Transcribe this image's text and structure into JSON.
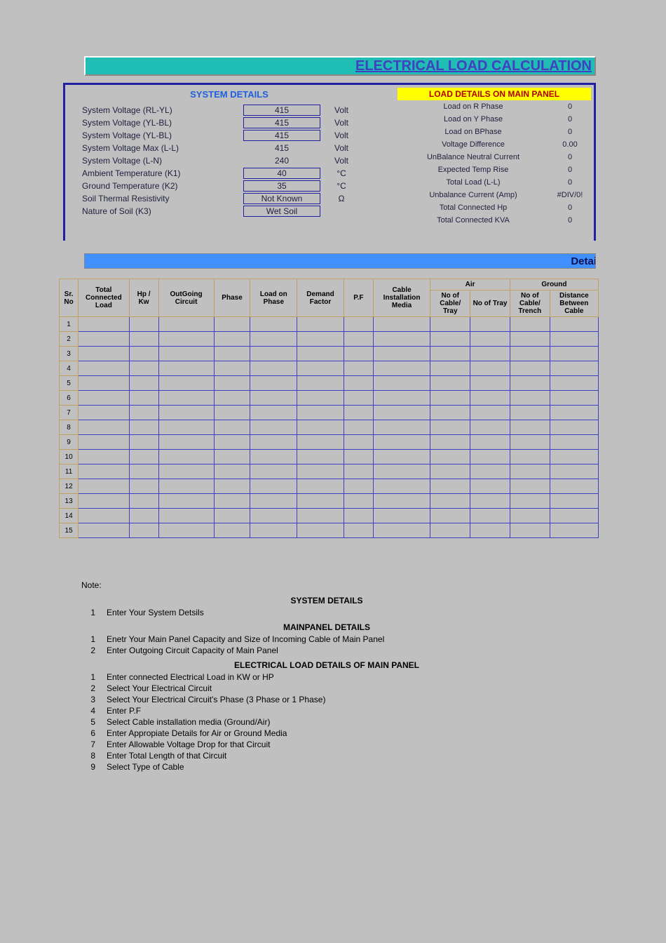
{
  "title": "ELECTRICAL LOAD CALCULATION",
  "detail_bar": "Detai",
  "system_details": {
    "header": "SYSTEM DETAILS",
    "rows": [
      {
        "label": "System Voltage (RL-YL)",
        "value": "415",
        "unit": "Volt",
        "boxed": true
      },
      {
        "label": "System Voltage (YL-BL)",
        "value": "415",
        "unit": "Volt",
        "boxed": true
      },
      {
        "label": "System Voltage (YL-BL)",
        "value": "415",
        "unit": "Volt",
        "boxed": true
      },
      {
        "label": "System Voltage Max (L-L)",
        "value": "415",
        "unit": "Volt",
        "boxed": false
      },
      {
        "label": "System Voltage (L-N)",
        "value": "240",
        "unit": "Volt",
        "boxed": false
      },
      {
        "label": "Ambient Temperature (K1)",
        "value": "40",
        "unit": "°C",
        "boxed": true
      },
      {
        "label": "Ground Temperature (K2)",
        "value": "35",
        "unit": "°C",
        "boxed": true
      },
      {
        "label": "Soil Thermal Resistivity",
        "value": "Not Known",
        "unit": "Ω",
        "boxed": true
      },
      {
        "label": "Nature of Soil (K3)",
        "value": "Wet Soil",
        "unit": "",
        "boxed": true
      }
    ]
  },
  "load_details": {
    "header": "LOAD DETAILS ON MAIN PANEL",
    "rows": [
      {
        "label": "Load on R Phase",
        "value": "0"
      },
      {
        "label": "Load on Y Phase",
        "value": "0"
      },
      {
        "label": "Load on BPhase",
        "value": "0"
      },
      {
        "label": "Voltage Difference",
        "value": "0.00"
      },
      {
        "label": "UnBalance Neutral Current",
        "value": "0"
      },
      {
        "label": "Expected Temp Rise",
        "value": "0"
      },
      {
        "label": "Total Load (L-L)",
        "value": "0"
      },
      {
        "label": "Unbalance Current (Amp)",
        "value": "#DIV/0!"
      },
      {
        "label": "Total Connected Hp",
        "value": "0"
      },
      {
        "label": "Total Connected KVA",
        "value": "0"
      }
    ]
  },
  "grid": {
    "headers": {
      "srno": "Sr. No",
      "total_conn": "Total Connected Load",
      "hpkw": "Hp / Kw",
      "outgoing": "OutGoing Circuit",
      "phase": "Phase",
      "load_phase": "Load on Phase",
      "demand": "Demand Factor",
      "pf": "P.F",
      "media": "Cable Installation Media",
      "air": "Air",
      "ground": "Ground",
      "air_cable": "No of Cable/ Tray",
      "air_tray": "No of Tray",
      "gnd_cable": "No of Cable/ Trench",
      "gnd_dist": "Distance Between Cable"
    },
    "rows": [
      1,
      2,
      3,
      4,
      5,
      6,
      7,
      8,
      9,
      10,
      11,
      12,
      13,
      14,
      15
    ]
  },
  "notes": {
    "label": "Note:",
    "sections": [
      {
        "title": "SYSTEM DETAILS",
        "items": [
          {
            "n": "1",
            "t": "Enter Your System Detsils"
          }
        ]
      },
      {
        "title": "MAINPANEL DETAILS",
        "items": [
          {
            "n": "1",
            "t": "Enetr Your Main Panel Capacity and Size of Incoming Cable of Main Panel"
          },
          {
            "n": "2",
            "t": "Enter Outgoing Circuit Capacity of Main Panel"
          }
        ]
      },
      {
        "title": "ELECTRICAL LOAD DETAILS OF MAIN PANEL",
        "items": [
          {
            "n": "1",
            "t": "Enter connected Electrical  Load in KW or HP"
          },
          {
            "n": "2",
            "t": "Select Your Electrical Circuit"
          },
          {
            "n": "3",
            "t": "Select Your Electrical Circuit's Phase  (3 Phase or 1 Phase)"
          },
          {
            "n": "4",
            "t": "Enter P.F"
          },
          {
            "n": "5",
            "t": "Select  Cable installation media (Ground/Air)"
          },
          {
            "n": "6",
            "t": "Enter Appropiate Details for Air or Ground Media"
          },
          {
            "n": "7",
            "t": "Enter Allowable Voltage Drop for that Circuit"
          },
          {
            "n": "8",
            "t": "Enter Total Length of that Circuit"
          },
          {
            "n": "9",
            "t": "Select Type of Cable"
          }
        ]
      }
    ]
  }
}
